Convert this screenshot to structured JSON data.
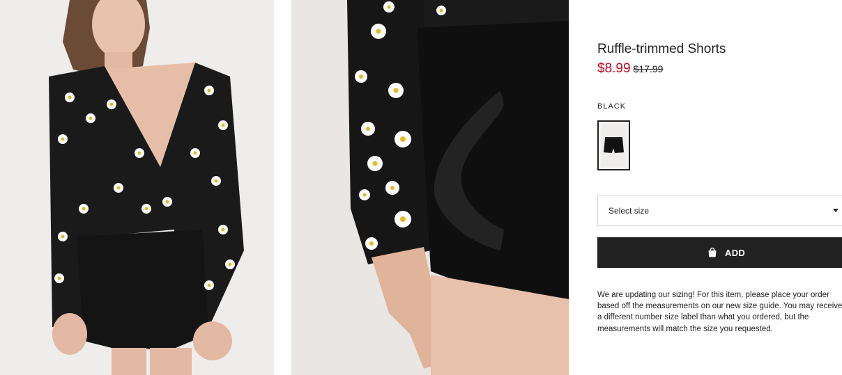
{
  "product": {
    "title": "Ruffle-trimmed Shorts",
    "sale_price": "$8.99",
    "original_price": "$17.99",
    "color_label": "BLACK"
  },
  "size_selector": {
    "placeholder": "Select size"
  },
  "add_button": {
    "label": "ADD"
  },
  "notice_text": "We are updating our sizing! For this item, please place your order based off the measurements on our new size guide. You may receive a different number size label than what you ordered, but the measurements will match the size you requested.",
  "colors": {
    "sale_price": "#d0021b",
    "button_bg": "#222222",
    "text": "#222222"
  },
  "icons": {
    "add_button_icon": "shopping-bag-icon",
    "select_icon": "chevron-down-icon"
  }
}
